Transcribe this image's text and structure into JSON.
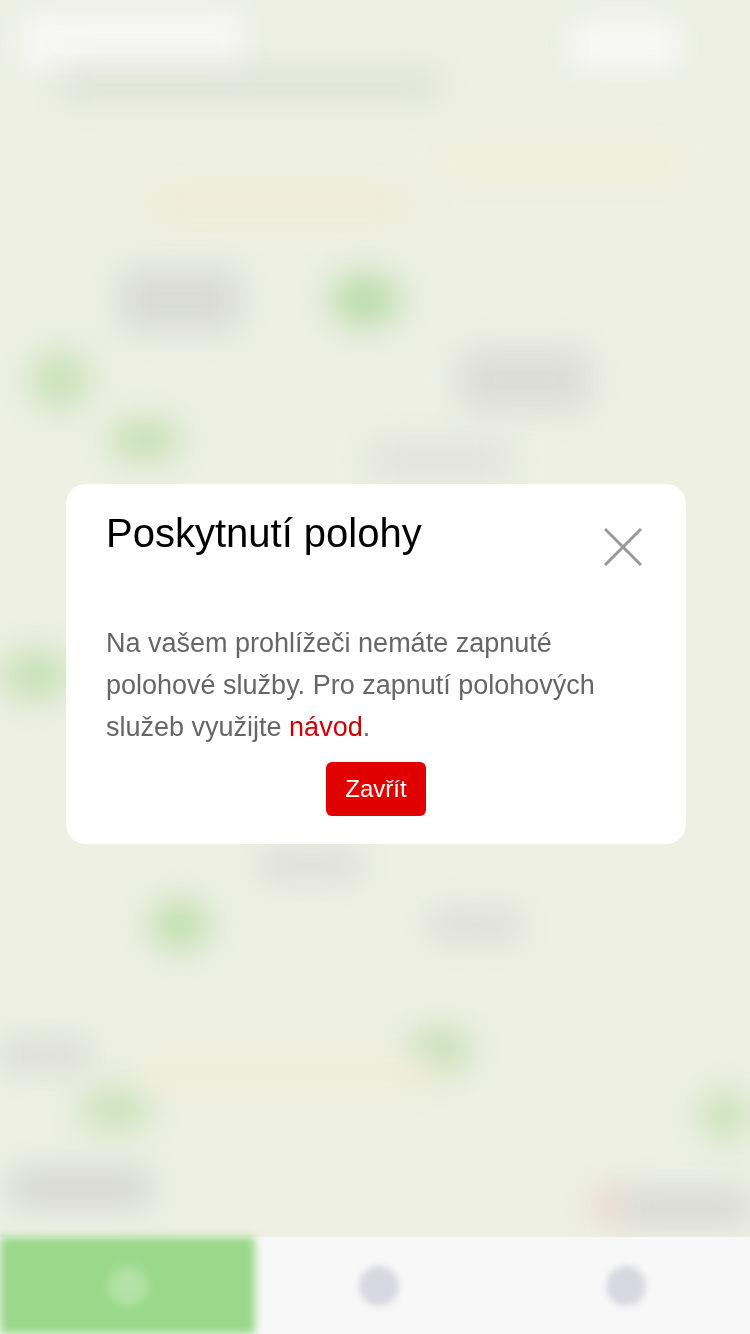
{
  "dialog": {
    "title": "Poskytnutí polohy",
    "message": "Na vašem prohlížeči nemáte zapnuté polohové služby. Pro zapnutí polohových služeb využijte ",
    "link": "návod",
    "message_end": ".",
    "button": "Zavřít"
  }
}
